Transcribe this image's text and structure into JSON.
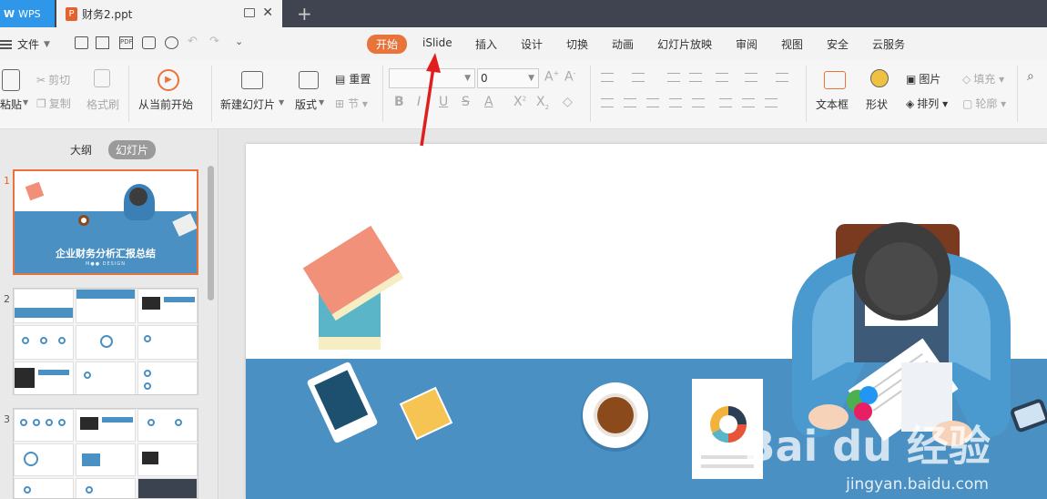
{
  "titlebar": {
    "app_tab": "WPS",
    "file_tab": "财务2.ppt",
    "file_icon": "P",
    "add_tab": "+"
  },
  "menubar": {
    "file_label": "文件",
    "items": [
      "开始",
      "iSlide",
      "插入",
      "设计",
      "切换",
      "动画",
      "幻灯片放映",
      "审阅",
      "视图",
      "安全",
      "云服务"
    ],
    "active_index": 0
  },
  "ribbon": {
    "paste": "粘贴",
    "cut": "剪切",
    "copy": "复制",
    "format_painter": "格式刷",
    "play_from_current": "从当前开始",
    "new_slide": "新建幻灯片",
    "layout": "版式",
    "reset": "重置",
    "section": "节",
    "font_name": "",
    "font_size": "0",
    "textbox": "文本框",
    "shape": "形状",
    "picture": "图片",
    "arrange": "排列",
    "fill": "填充",
    "outline": "轮廓"
  },
  "panel": {
    "tabs": [
      "大纲",
      "幻灯片"
    ],
    "active_tab": 1,
    "slide_numbers": [
      "1",
      "2",
      "3"
    ],
    "slide1_title": "企业财务分析汇报总结",
    "slide1_subtitle": "M●● DESIGN"
  },
  "watermark": {
    "text": "Bai du 经验",
    "url": "jingyan.baidu.com"
  },
  "colors": {
    "accent": "#e8743b",
    "slide_blue": "#4a90c2",
    "wps_blue": "#2f97e9",
    "annotation_arrow": "#e01e1e"
  }
}
